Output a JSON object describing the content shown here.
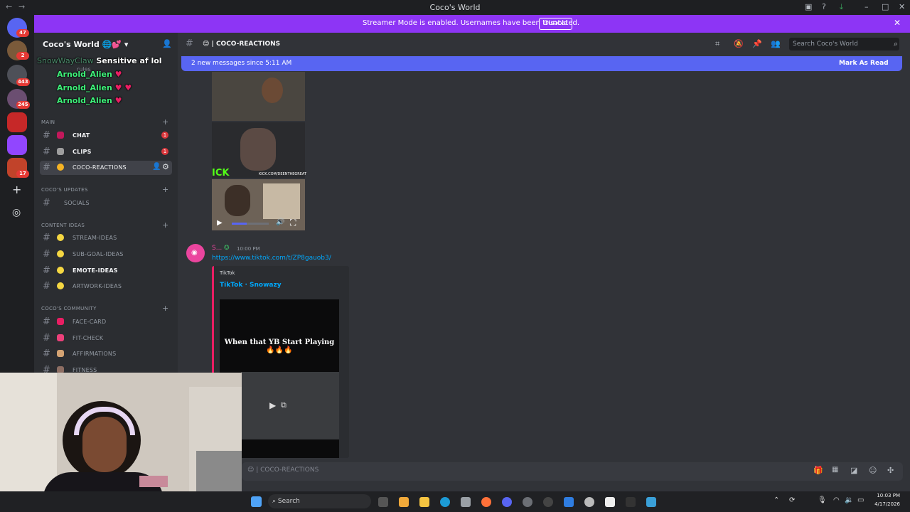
{
  "window": {
    "title": "Coco's World",
    "nav_back": "←",
    "nav_fwd": "→"
  },
  "banner": {
    "text": "Streamer Mode is enabled. Usernames have been truncated.",
    "disable_label": "Disable",
    "close": "✕",
    "color": "#8d35f5"
  },
  "rail": {
    "badges": [
      "47",
      "2",
      "443",
      "245",
      "17"
    ],
    "add_server": "+",
    "explore": "◎"
  },
  "sidebar": {
    "server_name": "Coco's World",
    "top_channel": "rules",
    "categories": [
      {
        "label": "MAIN"
      },
      {
        "label": "COCO'S UPDATES"
      },
      {
        "label": "CONTENT IDEAS"
      },
      {
        "label": "COCO'S COMMUNITY"
      }
    ],
    "channels": [
      {
        "name": "CHAT",
        "badge": "1"
      },
      {
        "name": "CLIPS",
        "badge": "1"
      },
      {
        "name": "COCO-REACTIONS"
      },
      {
        "name": "SOCIALS"
      },
      {
        "name": "STREAM-IDEAS"
      },
      {
        "name": "SUB-GOAL-IDEAS"
      },
      {
        "name": "EMOTE-IDEAS"
      },
      {
        "name": "ARTWORK-IDEAS"
      },
      {
        "name": "FACE-CARD"
      },
      {
        "name": "FIT-CHECK"
      },
      {
        "name": "AFFIRMATIONS"
      },
      {
        "name": "FITNESS"
      }
    ]
  },
  "overlay_chat": [
    {
      "user": "SnowWayClaw",
      "text": "Sensitive af lol"
    },
    {
      "user": "Arnold_Alien",
      "text": ""
    },
    {
      "user": "Arnold_Alien",
      "text": ""
    },
    {
      "user": "Arnold_Alien",
      "text": ""
    }
  ],
  "header": {
    "channel": "COCO-REACTIONS",
    "search_placeholder": "Search Coco's World"
  },
  "new_messages": {
    "text": "2 new messages since 5:11 AM",
    "mark_read": "Mark As Read"
  },
  "message": {
    "author": "S...",
    "time": "10:00 PM",
    "link": "https://www.tiktok.com/t/ZP8gauob3/",
    "embed_provider": "TikTok",
    "embed_title": "TikTok · Snowazy",
    "video_caption": "When that YB Start Playing 🔥🔥🔥"
  },
  "clip": {
    "watermark": "KICK.COM/DEENTHEGREAT",
    "kick_text": "ICK"
  },
  "input": {
    "placeholder": "COCO-REACTIONS"
  },
  "taskbar": {
    "search": "Search",
    "time": "10:03 PM",
    "date": "4/17/2026"
  }
}
